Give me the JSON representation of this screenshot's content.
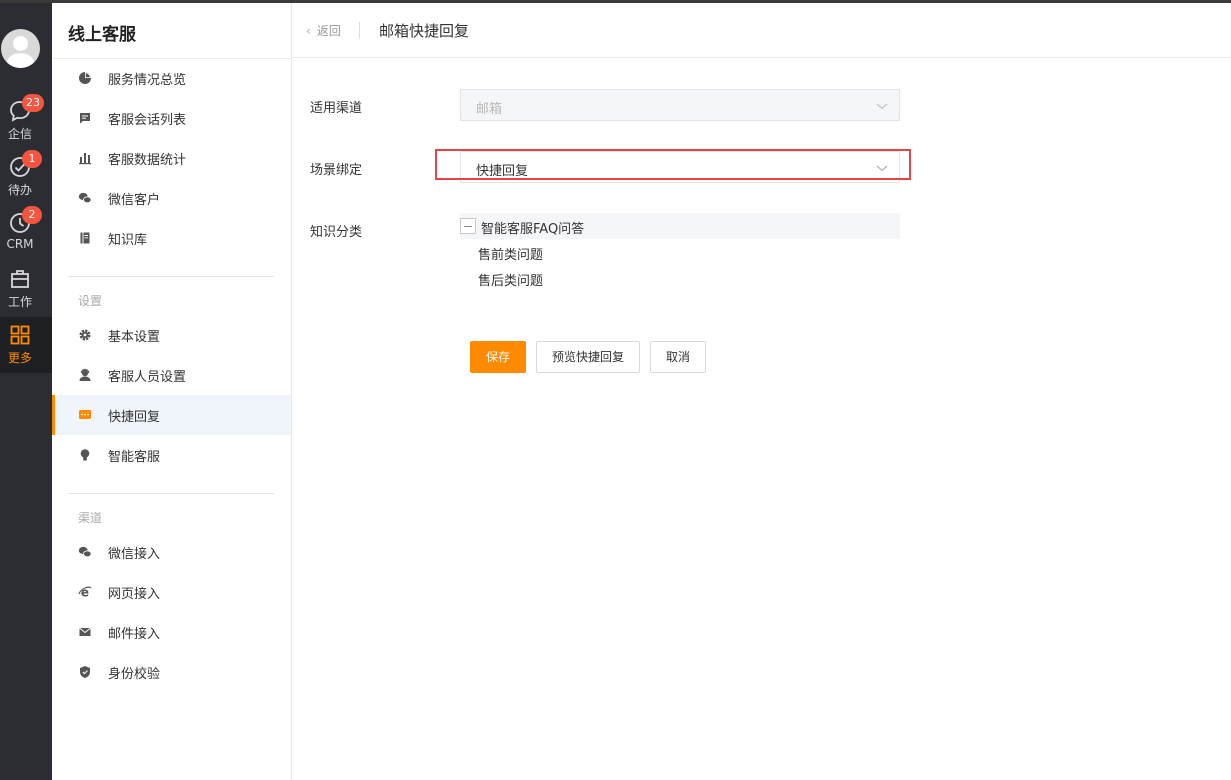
{
  "rail": {
    "items": [
      {
        "label": "企信",
        "badge": "23"
      },
      {
        "label": "待办",
        "badge": "1"
      },
      {
        "label": "CRM",
        "badge": "2"
      },
      {
        "label": "工作",
        "badge": ""
      },
      {
        "label": "更多",
        "badge": ""
      }
    ],
    "active_color": "#ff8a00",
    "badge_color": "#f5553f"
  },
  "sidebar": {
    "title": "线上客服",
    "items": [
      {
        "label": "服务情况总览",
        "icon": "pie-chart-icon"
      },
      {
        "label": "客服会话列表",
        "icon": "chat-list-icon"
      },
      {
        "label": "客服数据统计",
        "icon": "bar-chart-icon"
      },
      {
        "label": "微信客户",
        "icon": "wechat-icon"
      },
      {
        "label": "知识库",
        "icon": "book-icon"
      }
    ],
    "settings_label": "设置",
    "settings_items": [
      {
        "label": "基本设置",
        "icon": "gear-icon"
      },
      {
        "label": "客服人员设置",
        "icon": "agent-icon"
      },
      {
        "label": "快捷回复",
        "icon": "quick-reply-icon",
        "active": true
      },
      {
        "label": "智能客服",
        "icon": "bulb-icon"
      }
    ],
    "channels_label": "渠道",
    "channel_items": [
      {
        "label": "微信接入",
        "icon": "wechat-icon"
      },
      {
        "label": "网页接入",
        "icon": "ie-icon"
      },
      {
        "label": "邮件接入",
        "icon": "mail-icon"
      },
      {
        "label": "身份校验",
        "icon": "shield-icon"
      }
    ]
  },
  "header": {
    "back_label": "返回",
    "title": "邮箱快捷回复"
  },
  "form": {
    "channel": {
      "label": "适用渠道",
      "value": "邮箱",
      "disabled": true
    },
    "scene": {
      "label": "场景绑定",
      "value": "快捷回复"
    },
    "knowledge": {
      "label": "知识分类",
      "root": "智能客服FAQ问答",
      "children": [
        "售前类问题",
        "售后类问题"
      ]
    }
  },
  "buttons": {
    "save": "保存",
    "preview": "预览快捷回复",
    "cancel": "取消"
  }
}
